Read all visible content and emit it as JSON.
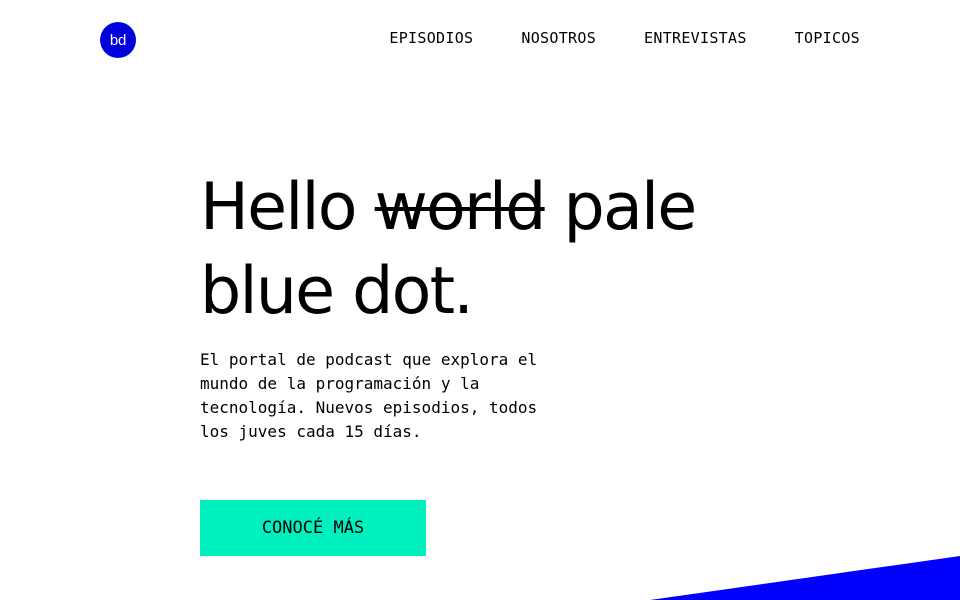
{
  "brand": {
    "logo_text": "bd",
    "accent_color": "#0000dc"
  },
  "nav": {
    "items": [
      {
        "label": "EPISODIOS"
      },
      {
        "label": "NOSOTROS"
      },
      {
        "label": "ENTREVISTAS"
      },
      {
        "label": "TOPICOS"
      }
    ]
  },
  "hero": {
    "title_prefix": "Hello",
    "title_struck": "world",
    "title_suffix": "pale",
    "title_line2": "blue dot.",
    "description": "El portal de podcast que explora el mundo de la programación y la tecnología. Nuevos episodios, todos los juves cada 15 días.",
    "cta_label": "CONOCÉ MÁS",
    "cta_color": "#00f0c0"
  },
  "decoration": {
    "shape_color": "#0000ff"
  }
}
